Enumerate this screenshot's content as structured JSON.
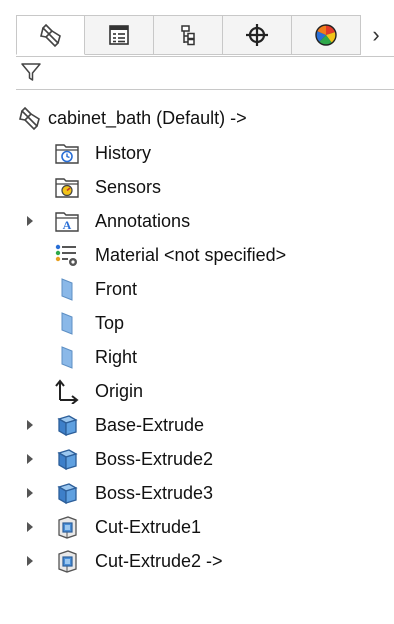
{
  "tabs": [
    {
      "name": "feature-manager",
      "icon": "part-icon"
    },
    {
      "name": "property-manager",
      "icon": "property-list-icon"
    },
    {
      "name": "configuration-manager",
      "icon": "configuration-tree-icon"
    },
    {
      "name": "dimxpert-manager",
      "icon": "crosshair-icon"
    },
    {
      "name": "display-manager",
      "icon": "appearance-sphere-icon"
    }
  ],
  "tabs_more_label": "›",
  "filter": {
    "icon": "filter-funnel-icon"
  },
  "tree": {
    "root": {
      "label": "cabinet_bath  (Default) ->",
      "icon": "part-icon"
    },
    "items": [
      {
        "label": "History",
        "icon": "history-folder-icon",
        "expandable": false
      },
      {
        "label": "Sensors",
        "icon": "sensors-folder-icon",
        "expandable": false
      },
      {
        "label": "Annotations",
        "icon": "annotations-folder-icon",
        "expandable": true
      },
      {
        "label": "Material <not specified>",
        "icon": "material-icon",
        "expandable": false
      },
      {
        "label": "Front",
        "icon": "plane-icon",
        "expandable": false
      },
      {
        "label": "Top",
        "icon": "plane-icon",
        "expandable": false
      },
      {
        "label": "Right",
        "icon": "plane-icon",
        "expandable": false
      },
      {
        "label": "Origin",
        "icon": "origin-icon",
        "expandable": false
      },
      {
        "label": "Base-Extrude",
        "icon": "extrude-feature-icon",
        "expandable": true
      },
      {
        "label": "Boss-Extrude2",
        "icon": "extrude-feature-icon",
        "expandable": true
      },
      {
        "label": "Boss-Extrude3",
        "icon": "extrude-feature-icon",
        "expandable": true
      },
      {
        "label": "Cut-Extrude1",
        "icon": "cut-extrude-icon",
        "expandable": true
      },
      {
        "label": "Cut-Extrude2 ->",
        "icon": "cut-extrude-icon",
        "expandable": true
      }
    ]
  },
  "colors": {
    "plane": "#8ab8e8",
    "feature": "#4a8fd8",
    "tab_border": "#c8c8c8"
  }
}
